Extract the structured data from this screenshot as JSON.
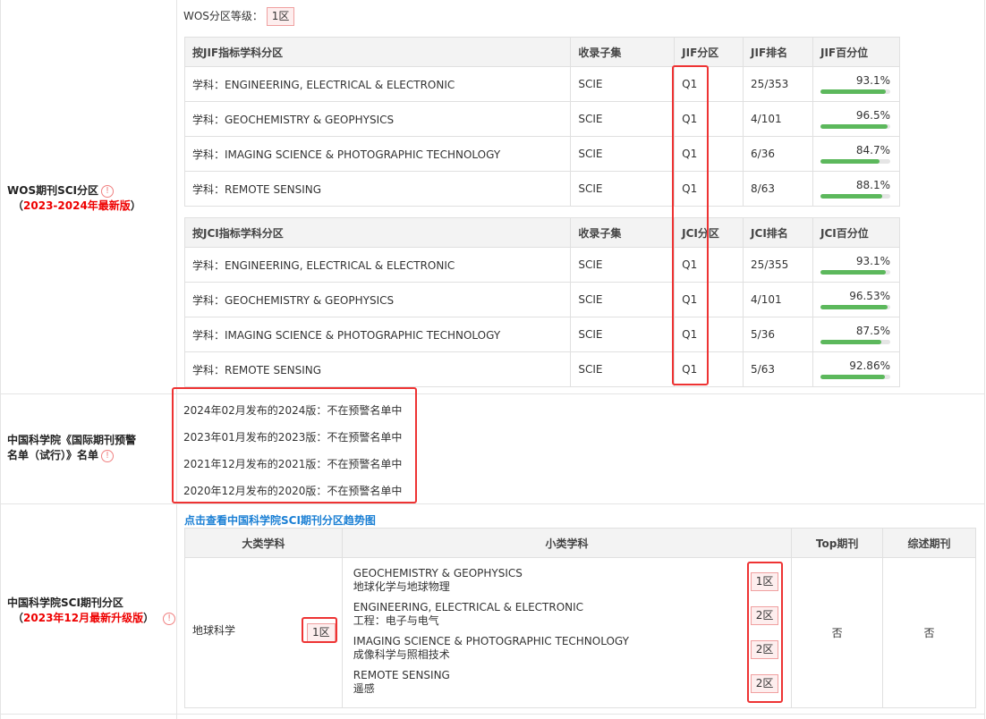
{
  "wos": {
    "title": "WOS期刊SCI分区",
    "subtitle": "2023-2024年最新版",
    "level_label": "WOS分区等级：",
    "level_value": "1区",
    "jif_table": {
      "headers": [
        "按JIF指标学科分区",
        "收录子集",
        "JIF分区",
        "JIF排名",
        "JIF百分位"
      ],
      "rows": [
        {
          "subject": "学科：ENGINEERING, ELECTRICAL & ELECTRONIC",
          "subset": "SCIE",
          "quartile": "Q1",
          "rank": "25/353",
          "pct": "93.1%",
          "pct_value": 93.1
        },
        {
          "subject": "学科：GEOCHEMISTRY & GEOPHYSICS",
          "subset": "SCIE",
          "quartile": "Q1",
          "rank": "4/101",
          "pct": "96.5%",
          "pct_value": 96.5
        },
        {
          "subject": "学科：IMAGING SCIENCE & PHOTOGRAPHIC TECHNOLOGY",
          "subset": "SCIE",
          "quartile": "Q1",
          "rank": "6/36",
          "pct": "84.7%",
          "pct_value": 84.7
        },
        {
          "subject": "学科：REMOTE SENSING",
          "subset": "SCIE",
          "quartile": "Q1",
          "rank": "8/63",
          "pct": "88.1%",
          "pct_value": 88.1
        }
      ]
    },
    "jci_table": {
      "headers": [
        "按JCI指标学科分区",
        "收录子集",
        "JCI分区",
        "JCI排名",
        "JCI百分位"
      ],
      "rows": [
        {
          "subject": "学科：ENGINEERING, ELECTRICAL & ELECTRONIC",
          "subset": "SCIE",
          "quartile": "Q1",
          "rank": "25/355",
          "pct": "93.1%",
          "pct_value": 93.1
        },
        {
          "subject": "学科：GEOCHEMISTRY & GEOPHYSICS",
          "subset": "SCIE",
          "quartile": "Q1",
          "rank": "4/101",
          "pct": "96.53%",
          "pct_value": 96.53
        },
        {
          "subject": "学科：IMAGING SCIENCE & PHOTOGRAPHIC TECHNOLOGY",
          "subset": "SCIE",
          "quartile": "Q1",
          "rank": "5/36",
          "pct": "87.5%",
          "pct_value": 87.5
        },
        {
          "subject": "学科：REMOTE SENSING",
          "subset": "SCIE",
          "quartile": "Q1",
          "rank": "5/63",
          "pct": "92.86%",
          "pct_value": 92.86
        }
      ]
    }
  },
  "warning": {
    "title_line1": "中国科学院《国际期刊预警",
    "title_line2": "名单（试行）》名单",
    "items": [
      "2024年02月发布的2024版：不在预警名单中",
      "2023年01月发布的2023版：不在预警名单中",
      "2021年12月发布的2021版：不在预警名单中",
      "2020年12月发布的2020版：不在预警名单中"
    ]
  },
  "cas": {
    "title": "中国科学院SCI期刊分区",
    "subtitle": "2023年12月最新升级版",
    "trend_link": "点击查看中国科学院SCI期刊分区趋势图",
    "headers": [
      "大类学科",
      "小类学科",
      "Top期刊",
      "综述期刊"
    ],
    "major_subject": "地球科学",
    "major_zone": "1区",
    "minor": [
      {
        "en": "GEOCHEMISTRY & GEOPHYSICS",
        "cn": "地球化学与地球物理",
        "zone": "1区"
      },
      {
        "en": "ENGINEERING, ELECTRICAL & ELECTRONIC",
        "cn": "工程：电子与电气",
        "zone": "2区"
      },
      {
        "en": "IMAGING SCIENCE & PHOTOGRAPHIC TECHNOLOGY",
        "cn": "成像科学与照相技术",
        "zone": "2区"
      },
      {
        "en": "REMOTE SENSING",
        "cn": "遥感",
        "zone": "2区"
      }
    ],
    "top": "否",
    "review": "否"
  },
  "icons": {
    "info": "info-icon"
  },
  "colors": {
    "accent_red": "#e00000",
    "bar_green": "#5cb85c",
    "link_blue": "#1a7fd4"
  }
}
